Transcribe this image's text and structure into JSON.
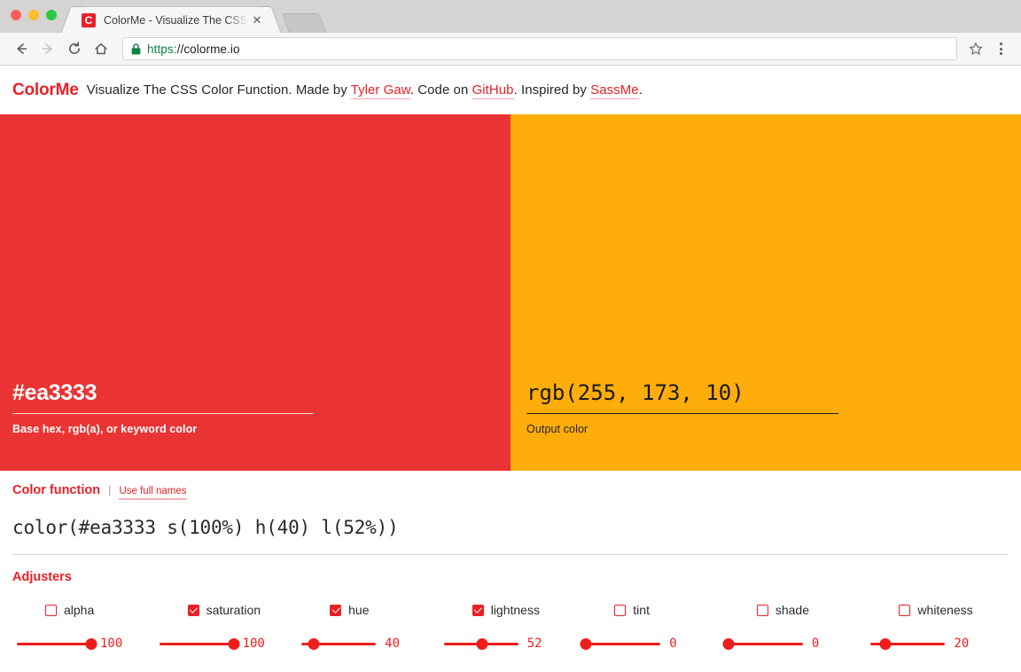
{
  "browser": {
    "traffic_lights": [
      "close",
      "minimize",
      "maximize"
    ],
    "tab": {
      "favicon_letter": "C",
      "title": "ColorMe - Visualize The CSS Color Function",
      "close_label": "✕"
    },
    "new_tab_label": "",
    "nav": {
      "back_label": "back",
      "forward_label": "forward",
      "reload_label": "reload",
      "home_label": "home"
    },
    "omnibox": {
      "scheme": "https:",
      "rest": "//colorme.io",
      "full_url": "https://colorme.io",
      "lock": "secure-lock"
    },
    "star_label": "bookmark",
    "menu_label": "chrome-menu"
  },
  "header": {
    "logo": "ColorMe",
    "tagline_part1": "Visualize The CSS Color Function. Made by ",
    "link_author": "Tyler Gaw",
    "tagline_part2": ". Code on ",
    "link_code": "GitHub",
    "tagline_part3": ". Inspired by ",
    "link_inspiration": "SassMe",
    "tagline_part4": "."
  },
  "panels": {
    "base": {
      "value": "#ea3333",
      "label": "Base hex, rgb(a), or keyword color",
      "placeholder": "#ea3333",
      "color": "#ea3333"
    },
    "output": {
      "value": "rgb(255, 173, 10)",
      "label": "Output color",
      "placeholder": "rgb(255, 173, 10)",
      "color": "#ffad0a"
    }
  },
  "color_function": {
    "title": "Color function",
    "separator": "|",
    "toggle_label": "Use full names",
    "value": "color(#ea3333 s(100%) h(40) l(52%))"
  },
  "adjusters": {
    "title": "Adjusters",
    "items": [
      {
        "name": "alpha",
        "checked": false,
        "value": 100,
        "display": "100",
        "percent": 100
      },
      {
        "name": "saturation",
        "checked": true,
        "value": 100,
        "display": "100",
        "percent": 100
      },
      {
        "name": "hue",
        "checked": true,
        "value": 40,
        "display": "40",
        "percent": 17
      },
      {
        "name": "lightness",
        "checked": true,
        "value": 52,
        "display": "52",
        "percent": 52
      },
      {
        "name": "tint",
        "checked": false,
        "value": 0,
        "display": "0",
        "percent": 0
      },
      {
        "name": "shade",
        "checked": false,
        "value": 0,
        "display": "0",
        "percent": 0
      },
      {
        "name": "whiteness",
        "checked": false,
        "value": 20,
        "display": "20",
        "percent": 20
      }
    ]
  },
  "theme": {
    "brand_red": "#ea2027",
    "base_color": "#ea3333",
    "output_color": "#ffad0a",
    "slider_red": "#ee1d1d"
  }
}
